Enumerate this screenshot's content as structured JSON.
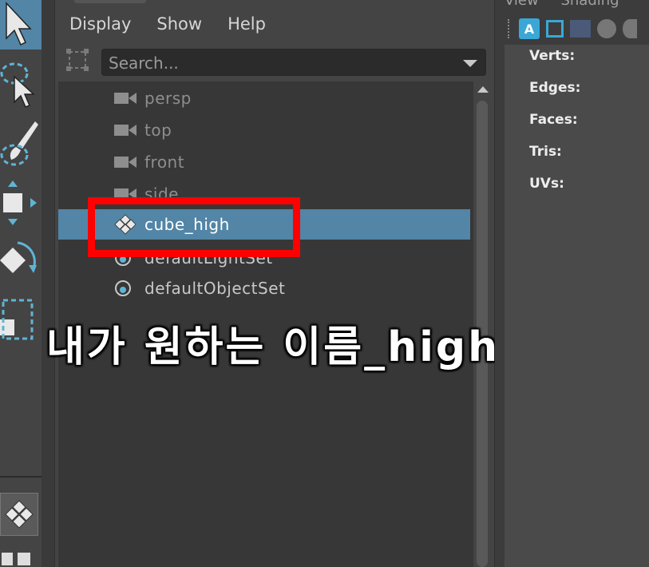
{
  "outliner": {
    "menu": [
      "Display",
      "Show",
      "Help"
    ],
    "search": {
      "placeholder": "Search..."
    },
    "items": [
      {
        "label": "persp",
        "icon": "camera-icon"
      },
      {
        "label": "top",
        "icon": "camera-icon"
      },
      {
        "label": "front",
        "icon": "camera-icon"
      },
      {
        "label": "side",
        "icon": "camera-icon"
      },
      {
        "label": "cube_high",
        "icon": "transform-node-icon",
        "selected": true
      },
      {
        "label": "defaultLightSet",
        "icon": "set-icon"
      },
      {
        "label": "defaultObjectSet",
        "icon": "set-icon"
      }
    ]
  },
  "annotation": {
    "caption": "내가 원하는 이름_high",
    "color": "#ff0000"
  },
  "viewport": {
    "menu": [
      "View",
      "Shading"
    ],
    "hud": [
      "Verts:",
      "Edges:",
      "Faces:",
      "Tris:",
      "UVs:"
    ]
  },
  "colors": {
    "selection": "#5285a6",
    "panel": "#444444",
    "tree_bg": "#373737"
  }
}
